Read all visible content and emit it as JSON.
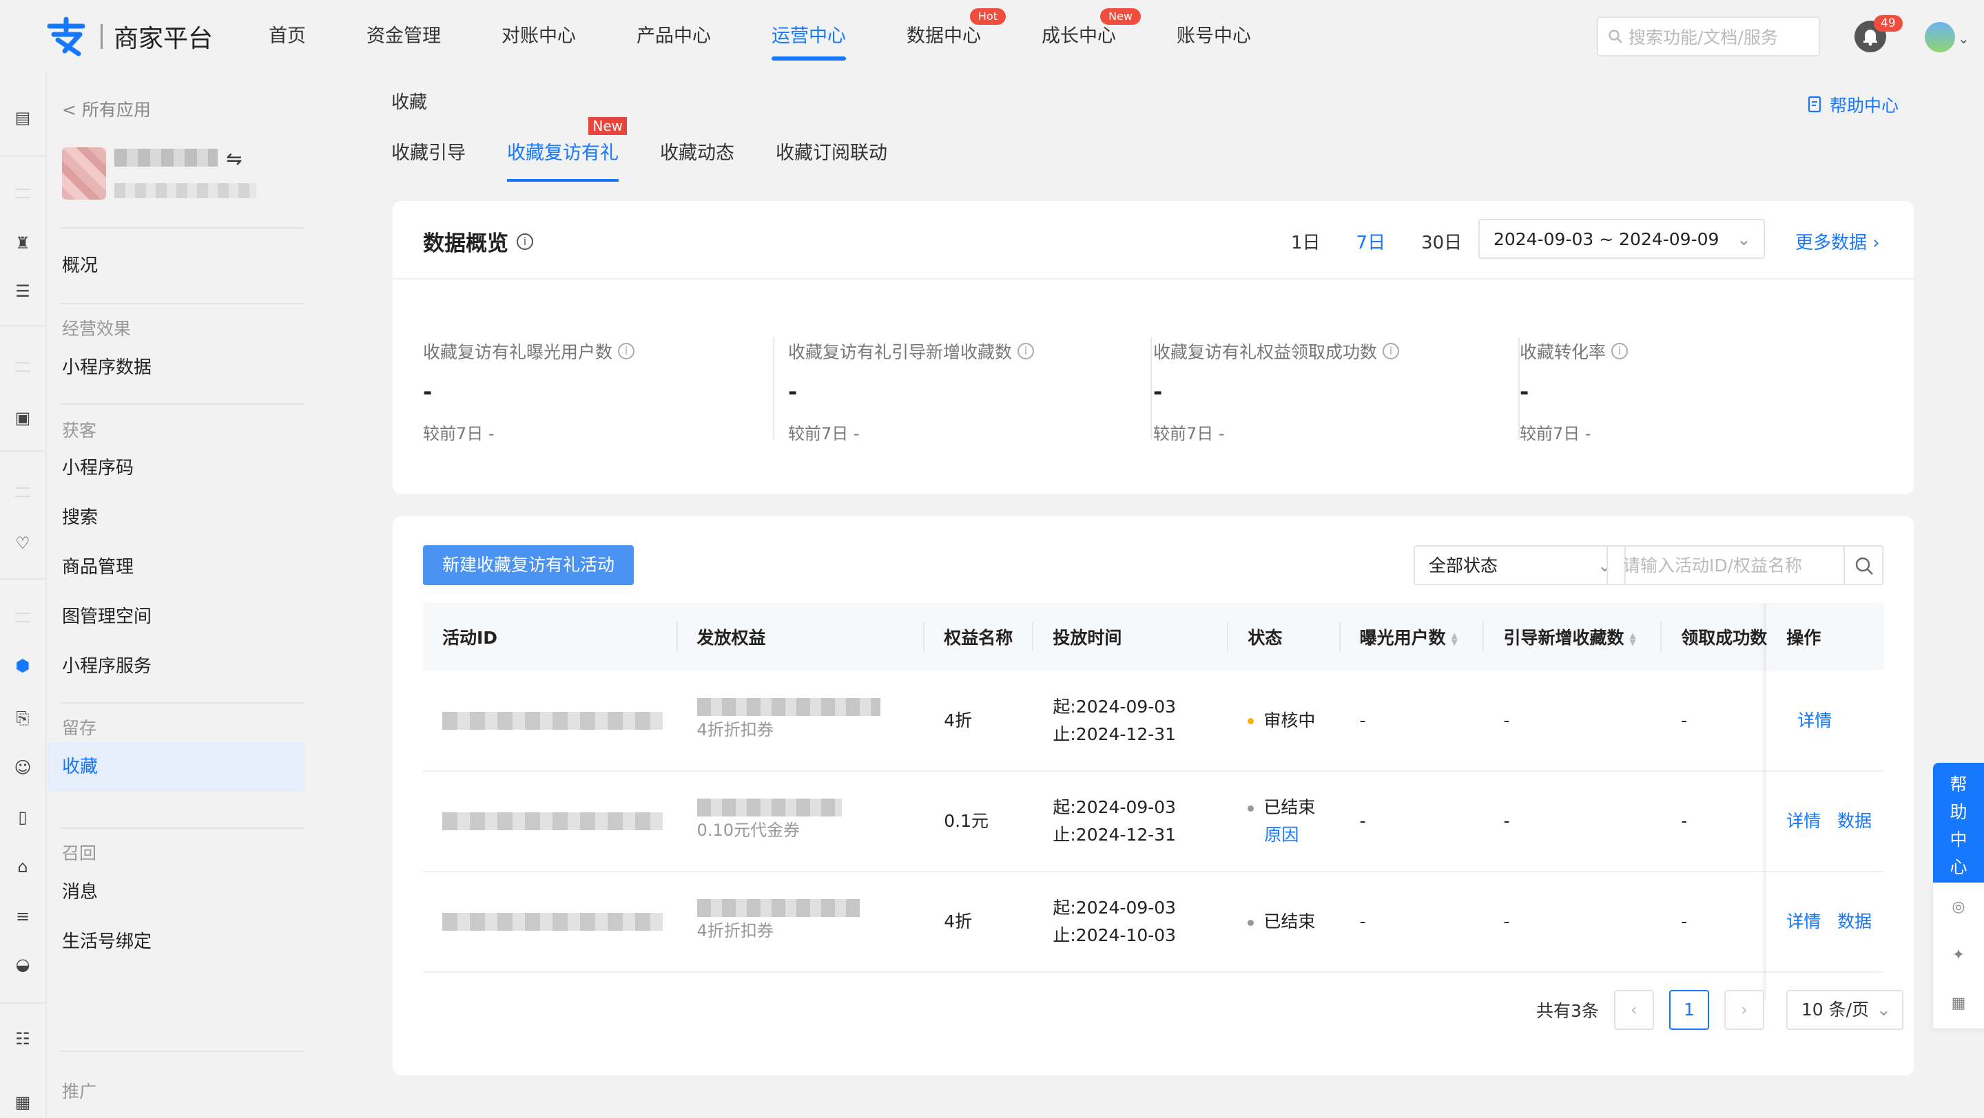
{
  "brand": {
    "name": "商家平台",
    "color": "#1677ff"
  },
  "topnav": {
    "items": [
      {
        "label": "首页"
      },
      {
        "label": "资金管理"
      },
      {
        "label": "对账中心"
      },
      {
        "label": "产品中心"
      },
      {
        "label": "运营中心",
        "active": true
      },
      {
        "label": "数据中心",
        "badge": "Hot"
      },
      {
        "label": "成长中心",
        "badge": "New"
      },
      {
        "label": "账号中心"
      }
    ],
    "search_placeholder": "搜索功能/文档/服务",
    "notification_count": "49"
  },
  "sidebar": {
    "back_label": "< 所有应用",
    "switch_icon": "⇋",
    "overview": "概况",
    "groups": {
      "effect": "经营效果",
      "acquire": "获客",
      "retain": "留存",
      "recall": "召回",
      "promote": "推广"
    },
    "items": {
      "mini_data": "小程序数据",
      "mini_code": "小程序码",
      "search": "搜索",
      "goods": "商品管理",
      "image_space": "图管理空间",
      "mini_service": "小程序服务",
      "favorites": "收藏",
      "messages": "消息",
      "life_bind": "生活号绑定"
    }
  },
  "page": {
    "title": "收藏",
    "help_label": "帮助中心",
    "tabs": [
      {
        "label": "收藏引导"
      },
      {
        "label": "收藏复访有礼",
        "active": true,
        "badge": "New"
      },
      {
        "label": "收藏动态"
      },
      {
        "label": "收藏订阅联动"
      }
    ]
  },
  "overview": {
    "title": "数据概览",
    "ranges": [
      "1日",
      "7日",
      "30日"
    ],
    "date_range": "2024-09-03 ~ 2024-09-09",
    "more_label": "更多数据",
    "metrics": [
      {
        "label": "收藏复访有礼曝光用户数",
        "value": "-",
        "compare": "较前7日 -"
      },
      {
        "label": "收藏复访有礼引导新增收藏数",
        "value": "-",
        "compare": "较前7日 -"
      },
      {
        "label": "收藏复访有礼权益领取成功数",
        "value": "-",
        "compare": "较前7日 -"
      },
      {
        "label": "收藏转化率",
        "value": "-",
        "compare": "较前7日 -"
      }
    ]
  },
  "activities": {
    "new_button": "新建收藏复访有礼活动",
    "status_filter": "全部状态",
    "search_placeholder": "请输入活动ID/权益名称",
    "columns": {
      "id": "活动ID",
      "benefit": "发放权益",
      "benefit_name": "权益名称",
      "time": "投放时间",
      "status": "状态",
      "exposure": "曝光用户数",
      "new_fav": "引导新增收藏数",
      "claimed": "领取成功数",
      "actions": "操作"
    },
    "rows": [
      {
        "benefit_sub": "4折折扣券",
        "benefit_name": "4折",
        "start": "起:2024-09-03",
        "end": "止:2024-12-31",
        "status": "审核中",
        "status_color": "#faad14",
        "reason": "",
        "exposure": "-",
        "new_fav": "-",
        "claimed": "-",
        "detail": "详情",
        "data": ""
      },
      {
        "benefit_sub": "0.10元代金券",
        "benefit_name": "0.1元",
        "start": "起:2024-09-03",
        "end": "止:2024-12-31",
        "status": "已结束",
        "status_color": "#999999",
        "reason": "原因",
        "exposure": "-",
        "new_fav": "-",
        "claimed": "-",
        "detail": "详情",
        "data": "数据"
      },
      {
        "benefit_sub": "4折折扣券",
        "benefit_name": "4折",
        "start": "起:2024-09-03",
        "end": "止:2024-10-03",
        "status": "已结束",
        "status_color": "#999999",
        "reason": "",
        "exposure": "-",
        "new_fav": "-",
        "claimed": "-",
        "detail": "详情",
        "data": "数据"
      }
    ],
    "pagination": {
      "total": "共有3条",
      "current": "1",
      "page_size": "10 条/页"
    }
  },
  "float_help": {
    "label": "帮助中心"
  }
}
